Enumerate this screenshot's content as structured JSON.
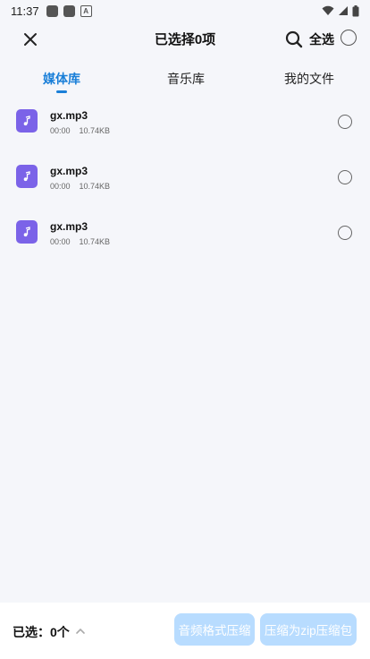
{
  "status_bar": {
    "time": "11:37",
    "notif_letter": "A"
  },
  "header": {
    "title": "已选择0项",
    "select_all_label": "全选"
  },
  "tabs": [
    {
      "label": "媒体库",
      "active": true
    },
    {
      "label": "音乐库",
      "active": false
    },
    {
      "label": "我的文件",
      "active": false
    }
  ],
  "files": [
    {
      "name": "gx.mp3",
      "duration": "00:00",
      "size": "10.74KB",
      "selected": false
    },
    {
      "name": "gx.mp3",
      "duration": "00:00",
      "size": "10.74KB",
      "selected": false
    },
    {
      "name": "gx.mp3",
      "duration": "00:00",
      "size": "10.74KB",
      "selected": false
    }
  ],
  "bottom": {
    "selected_text": "已选：0个",
    "btn_audio_compress": "音频格式压缩",
    "btn_zip_compress": "压缩为zip压缩包"
  },
  "colors": {
    "accent": "#1a7fd8",
    "file_icon": "#7b63e8",
    "button_disabled": "#b8dcff"
  },
  "icons": [
    "close-icon",
    "search-icon",
    "music-note-icon",
    "chevron-up-icon"
  ]
}
